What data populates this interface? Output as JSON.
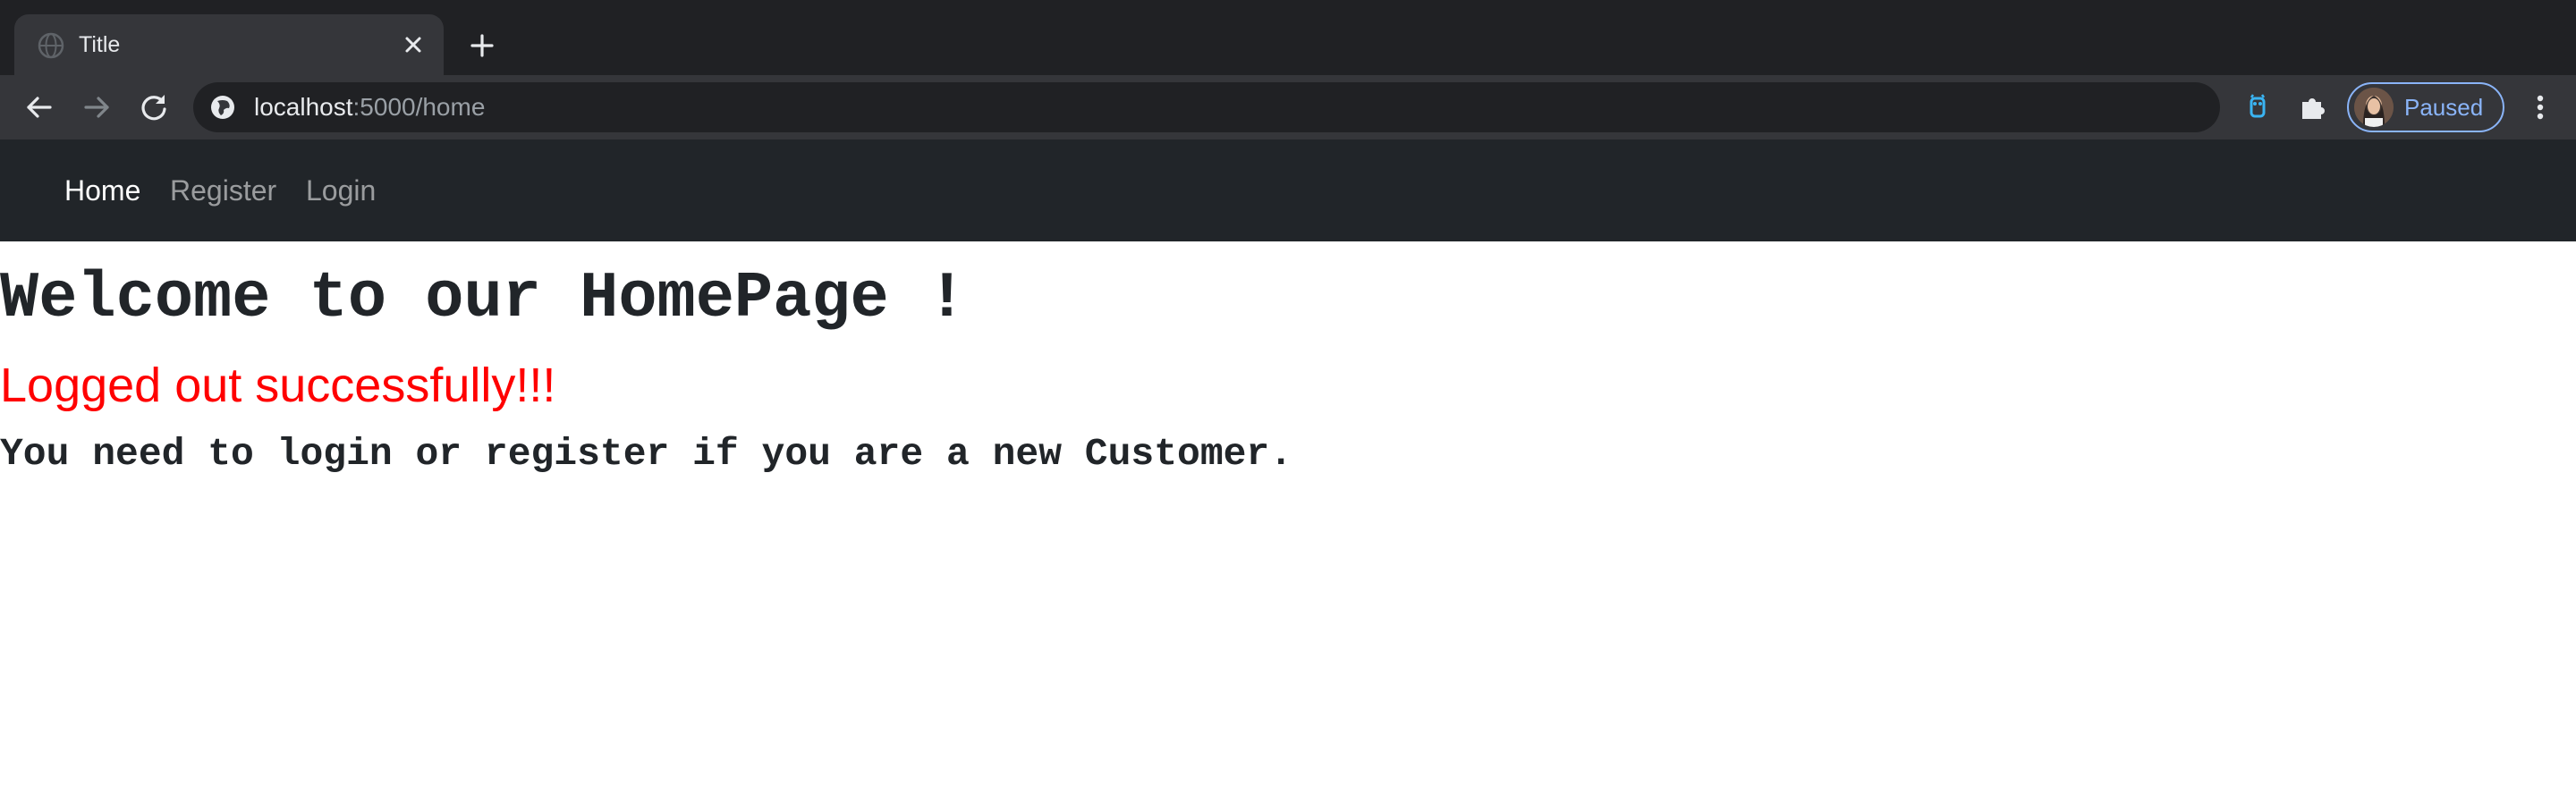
{
  "browser": {
    "tab": {
      "title": "Title",
      "favicon": "globe-icon",
      "close_icon": "close-icon"
    },
    "new_tab_icon": "plus-icon",
    "toolbar": {
      "back_icon": "arrow-left-icon",
      "forward_icon": "arrow-right-icon",
      "reload_icon": "reload-icon",
      "site_info_icon": "globe-icon",
      "url_host": "localhost",
      "url_path": ":5000/home",
      "extensions": [
        "owl-extension-icon",
        "puzzle-piece-icon"
      ],
      "profile_label": "Paused",
      "menu_icon": "vertical-dots-icon"
    },
    "colors": {
      "tabstrip": "#202124",
      "toolbar": "#35363a",
      "accent": "#8ab4f8"
    }
  },
  "page": {
    "navbar": {
      "links": [
        {
          "label": "Home",
          "active": true
        },
        {
          "label": "Register",
          "active": false
        },
        {
          "label": "Login",
          "active": false
        }
      ]
    },
    "heading": "Welcome to our HomePage !",
    "flash_message": "Logged out successfully!!!",
    "subtext": "You need to login or register if you are a new Customer.",
    "colors": {
      "navbar_bg": "#212529",
      "flash": "#ff0000",
      "text": "#212529"
    }
  }
}
